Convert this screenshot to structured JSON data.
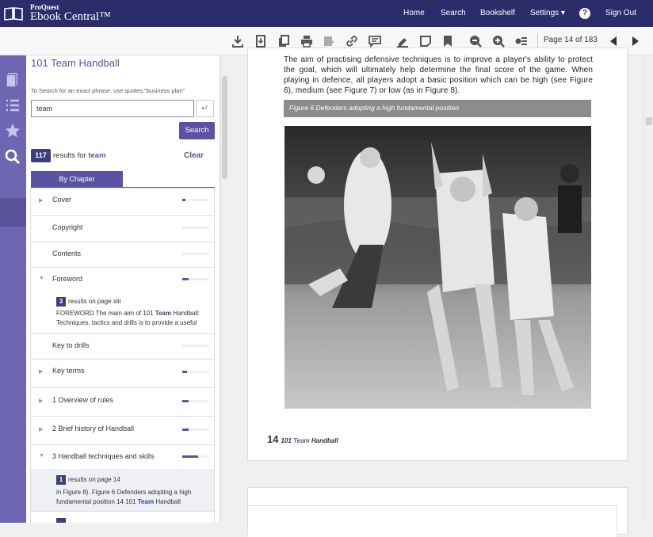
{
  "brand": {
    "small": "ProQuest",
    "big": "Ebook Central™"
  },
  "nav": {
    "home": "Home",
    "search": "Search",
    "bookshelf": "Bookshelf",
    "settings": "Settings ▾",
    "signout": "Sign Out",
    "help": "?"
  },
  "toolbar": {
    "page_indicator": "Page 14 of 183"
  },
  "sidebar": {
    "book_title": "101 Team Handball",
    "hint": "To Search for an exact phrase, use quotes:\"business plan\"",
    "search_value": "team",
    "enter_symbol": "↵",
    "search_button": "Search",
    "result_count": "117",
    "results_label": "results for",
    "results_term": "team",
    "clear": "Clear",
    "tab": "By Chapter",
    "chapters": [
      {
        "label": "Cover",
        "fill": 0.12
      },
      {
        "label": "Copyright",
        "fill": 0
      },
      {
        "label": "Contents",
        "fill": 0
      },
      {
        "label": "Foreword",
        "fill": 0.25
      },
      {
        "label": "Key to drills",
        "fill": 0
      },
      {
        "label": "Key terms",
        "fill": 0.18
      },
      {
        "label": "1 Overview of rules",
        "fill": 0.25
      },
      {
        "label": "2 Brief history of Handball",
        "fill": 0.25
      },
      {
        "label": "3 Handball techniques and skills",
        "fill": 0.6
      }
    ],
    "foreword_sub": {
      "count": "3",
      "where": "results on page xiii",
      "snippet_a": "FOREWORD The main aim of 101",
      "snippet_kw": "Team",
      "snippet_b": "Handball:",
      "snippet_line2": "Techniques, tactics and drills is to provide a useful"
    },
    "ch3_sub": {
      "count": "1",
      "where": "results on page 14",
      "line1": "in Figure 8). Figure 6 Defenders adopting a high",
      "line2_a": "fundamental position 14 101",
      "line2_kw": "Team",
      "line2_b": "Handball"
    }
  },
  "document": {
    "paragraph": "The aim of practising defensive techniques is to improve a player's ability to protect the goal, which will ultimately help determine the final score of the game. When playing in defence, all players adopt a basic position which can be high (see Figure 6), medium (see Figure 7) or low (as in Figure 8).",
    "caption": "Figure 6  Defenders adopting a high fundamental position",
    "footer_num": "14",
    "footer_a": "101",
    "footer_kw": "Team",
    "footer_b": "Handball"
  },
  "colors": {
    "topbar": "#2b2d6b",
    "accent": "#5b52a3",
    "rail": "#6e66b2"
  }
}
